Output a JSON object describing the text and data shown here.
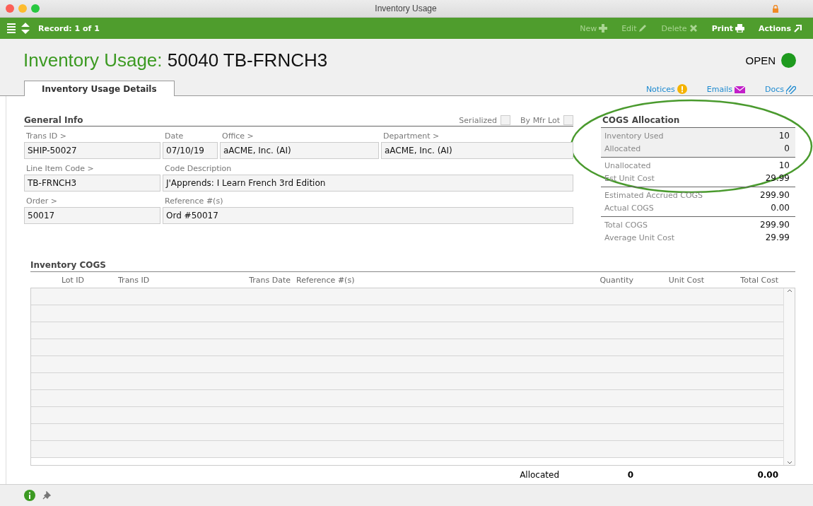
{
  "window": {
    "title": "Inventory Usage"
  },
  "toolbar": {
    "record": "Record: 1 of 1",
    "actions": [
      {
        "label": "New",
        "disabled": true
      },
      {
        "label": "Edit",
        "disabled": true
      },
      {
        "label": "Delete",
        "disabled": true
      },
      {
        "label": "Print",
        "disabled": false
      },
      {
        "label": "Actions",
        "disabled": false
      }
    ]
  },
  "header": {
    "title_prefix": "Inventory Usage:",
    "title_record": "50040 TB-FRNCH3",
    "status": "OPEN"
  },
  "tabs": [
    {
      "label": "Inventory Usage Details",
      "selected": true
    }
  ],
  "links": [
    {
      "label": "Notices"
    },
    {
      "label": "Emails"
    },
    {
      "label": "Docs"
    }
  ],
  "general_info": {
    "title": "General Info",
    "checkboxes": [
      {
        "label": "Serialized",
        "checked": false
      },
      {
        "label": "By Mfr Lot",
        "checked": false
      }
    ],
    "rows": [
      [
        {
          "label": "Trans ID >",
          "value": "SHIP-50027"
        },
        {
          "label": "Date",
          "value": "07/10/19"
        },
        {
          "label": "Office >",
          "value": "aACME, Inc.  (AI)"
        },
        {
          "label": "Department >",
          "value": "aACME, Inc.  (AI)"
        }
      ],
      [
        {
          "label": "Line Item Code >",
          "value": "TB-FRNCH3"
        },
        {
          "label": "Code Description",
          "value": "J'Apprends: I Learn French 3rd Edition"
        }
      ],
      [
        {
          "label": "Order >",
          "value": "50017"
        },
        {
          "label": "Reference #(s)",
          "value": "Ord #50017"
        }
      ]
    ]
  },
  "cogs_allocation": {
    "title": "COGS Allocation",
    "groups": [
      {
        "shaded": true,
        "lines": [
          {
            "label": "Inventory Used",
            "value": "10"
          },
          {
            "label": "Allocated",
            "value": "0"
          }
        ]
      },
      {
        "shaded": false,
        "lines": [
          {
            "label": "Unallocated",
            "value": "10"
          },
          {
            "label": "Est Unit Cost",
            "value": "29.99"
          }
        ]
      },
      {
        "shaded": false,
        "lines": [
          {
            "label": "Estimated Accrued COGS",
            "value": "299.90"
          },
          {
            "label": "Actual COGS",
            "value": "0.00"
          }
        ]
      },
      {
        "shaded": false,
        "lines": [
          {
            "label": "Total COGS",
            "value": "299.90"
          },
          {
            "label": "Average Unit Cost",
            "value": "29.99"
          }
        ]
      }
    ]
  },
  "inventory_cogs": {
    "title": "Inventory COGS",
    "columns": [
      {
        "label": "Lot ID"
      },
      {
        "label": "Trans ID"
      },
      {
        "label": "Trans Date"
      },
      {
        "label": "Reference #(s)"
      },
      {
        "label": "Quantity"
      },
      {
        "label": "Unit Cost"
      },
      {
        "label": "Total Cost"
      }
    ],
    "totals": {
      "label": "Allocated",
      "quantity": "0",
      "total_cost": "0.00"
    }
  }
}
